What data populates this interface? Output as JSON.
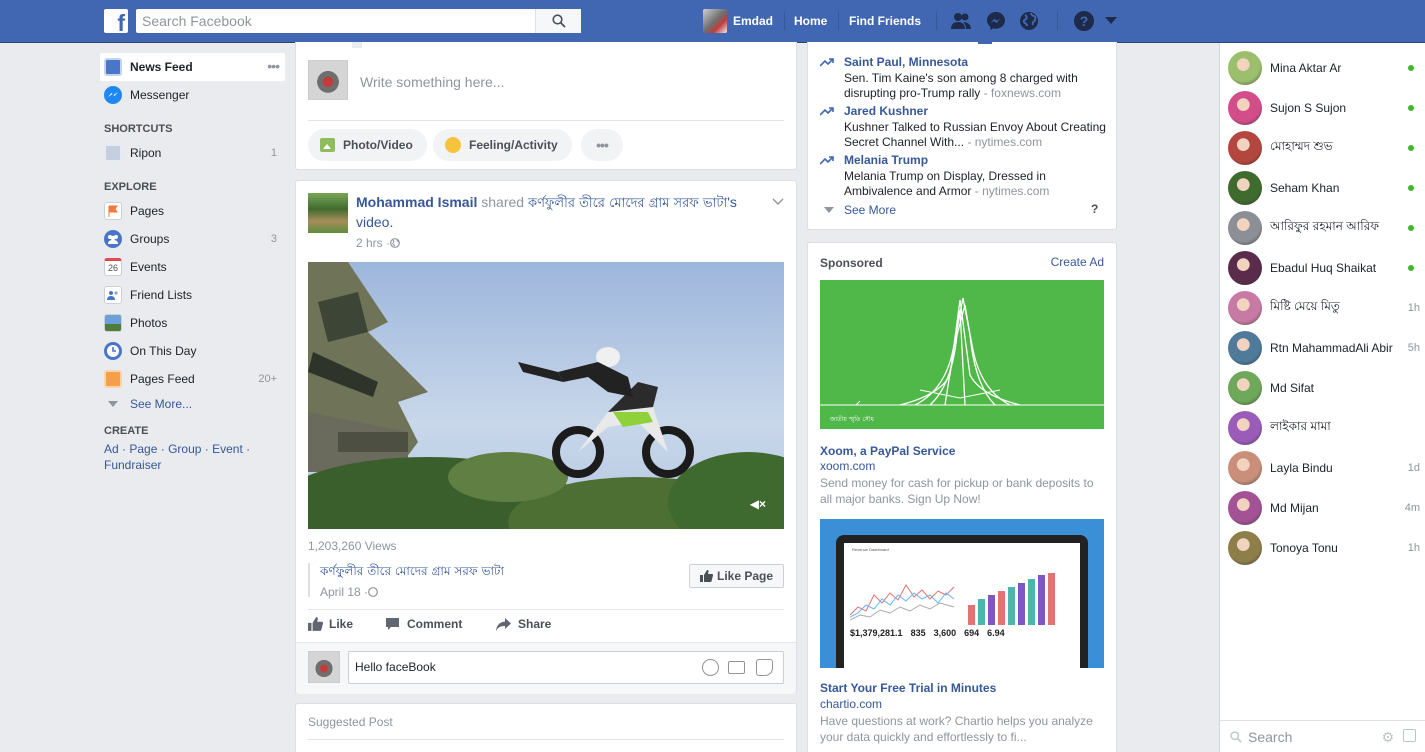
{
  "header": {
    "logo": "f",
    "search_placeholder": "Search Facebook",
    "profile_name": "Emdad",
    "home": "Home",
    "find_friends": "Find Friends"
  },
  "left_nav": {
    "news_feed": "News Feed",
    "messenger": "Messenger",
    "shortcuts_heading": "SHORTCUTS",
    "shortcut_ripon": "Ripon",
    "shortcut_ripon_count": "1",
    "explore_heading": "EXPLORE",
    "pages": "Pages",
    "groups": "Groups",
    "groups_count": "3",
    "events": "Events",
    "events_day": "26",
    "friend_lists": "Friend Lists",
    "photos": "Photos",
    "on_this_day": "On This Day",
    "pages_feed": "Pages Feed",
    "pages_feed_count": "20+",
    "see_more": "See More...",
    "create_heading": "CREATE",
    "create_ad": "Ad",
    "create_page": "Page",
    "create_group": "Group",
    "create_event": "Event",
    "create_fundraiser": "Fundraiser",
    "sep": " · "
  },
  "composer": {
    "placeholder": "Write something here...",
    "photo_video": "Photo/Video",
    "feeling_activity": "Feeling/Activity"
  },
  "post": {
    "author": "Mohammad Ismail",
    "shared": "shared",
    "page_name": "কর্ণফুলীর তীরে মোদের গ্রাম সরফ ভাটা",
    "suffix": "'s",
    "video_word": "video.",
    "time": "2 hrs · ",
    "views": "1,203,260 Views",
    "shared_page_title": "কর্ণফুলীর তীরে মোদের গ্রাম সরফ ভাটা",
    "shared_date": "April 18 · ",
    "like_page": "Like Page",
    "like": "Like",
    "comment": "Comment",
    "share": "Share",
    "comment_value": "Hello faceBook"
  },
  "suggested": {
    "heading": "Suggested Post"
  },
  "trending": [
    {
      "title": "Saint Paul, Minnesota",
      "desc": "Sen. Tim Kaine's son among 8 charged with disrupting pro-Trump rally",
      "source": " - foxnews.com"
    },
    {
      "title": "Jared Kushner",
      "desc": "Kushner Talked to Russian Envoy About Creating Secret Channel With...",
      "source": " - nytimes.com"
    },
    {
      "title": "Melania Trump",
      "desc": "Melania Trump on Display, Dressed in Ambivalence and Armor",
      "source": " - nytimes.com"
    }
  ],
  "trending_see_more": "See More",
  "trending_help": "?",
  "sponsored": {
    "heading": "Sponsored",
    "create_ad": "Create Ad",
    "ad1_caption": "জাতীয় স্মৃতি সৌধ",
    "ad1_title": "Xoom, a PayPal Service",
    "ad1_domain": "xoom.com",
    "ad1_desc": "Send money for cash for pickup or bank deposits to all major banks. Sign Up Now!",
    "ad2_dash_title": "Revenue Dashboard",
    "ad2_stat1": "$1,379,281.1",
    "ad2_stat2": "835",
    "ad2_stat3": "3,600",
    "ad2_stat4": "694",
    "ad2_stat5": "6.94",
    "ad2_title": "Start Your Free Trial in Minutes",
    "ad2_domain": "chartio.com",
    "ad2_desc": "Have questions at work? Chartio helps you analyze your data quickly and effortlessly to fi..."
  },
  "chat": {
    "search_placeholder": "Search",
    "contacts": [
      {
        "name": "Mina Aktar Ar",
        "status": "online",
        "color": "#9cbf6d"
      },
      {
        "name": "Sujon S Sujon",
        "status": "online",
        "color": "#d24d8a"
      },
      {
        "name": "মোহাম্মদ শুভ",
        "status": "online",
        "color": "#b3473f"
      },
      {
        "name": "Seham Khan",
        "status": "online",
        "color": "#3f6b2e"
      },
      {
        "name": "আরিফুর রহমান আরিফ",
        "status": "online",
        "color": "#8c8f95"
      },
      {
        "name": "Ebadul Huq Shaikat",
        "status": "online",
        "color": "#5a2b4b"
      },
      {
        "name": "মিষ্টি মেয়ে মিতু",
        "status": "1h",
        "color": "#c77aa3"
      },
      {
        "name": "Rtn MahammadAli Abir",
        "status": "5h",
        "color": "#4f7a9a"
      },
      {
        "name": "Md Sifat",
        "status": "",
        "color": "#6fa85a"
      },
      {
        "name": "লাইকার মামা",
        "status": "",
        "color": "#9b5bb8"
      },
      {
        "name": "Layla Bindu",
        "status": "1d",
        "color": "#c98f7a"
      },
      {
        "name": "Md Mijan",
        "status": "4m",
        "color": "#a35296"
      },
      {
        "name": "Tonoya Tonu",
        "status": "1h",
        "color": "#8e7e4a"
      }
    ]
  },
  "colors": {
    "brand": "#4267b2",
    "link": "#365899",
    "online": "#42b72a",
    "ad1_bg": "#4fb848",
    "ad2_bg": "#3a8fd6"
  }
}
